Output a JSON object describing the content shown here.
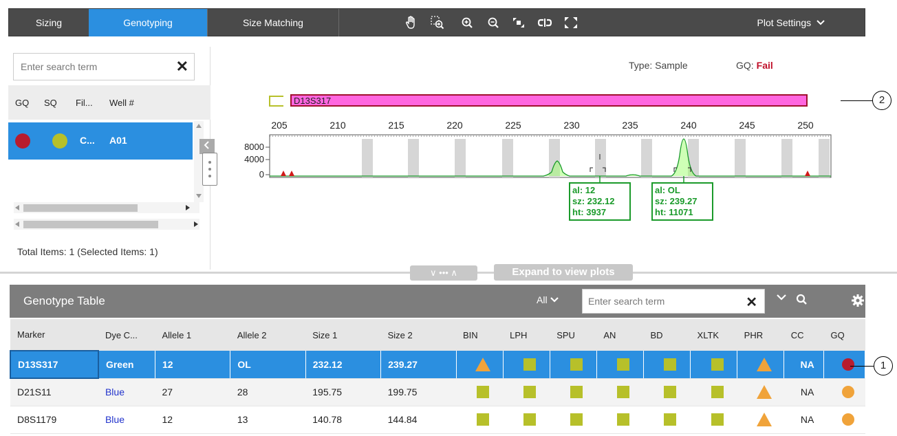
{
  "toolbar": {
    "tabs": [
      {
        "label": "Sizing",
        "active": false
      },
      {
        "label": "Genotyping",
        "active": true
      },
      {
        "label": "Size Matching",
        "active": false
      }
    ],
    "icons": [
      "pan-hand-icon",
      "zoom-box-icon",
      "zoom-in-icon",
      "zoom-out-icon",
      "fit-to-view-icon",
      "link-icon",
      "expand-icon"
    ],
    "plot_settings_label": "Plot Settings"
  },
  "sample_panel": {
    "search_placeholder": "Enter search term",
    "columns": [
      "GQ",
      "SQ",
      "Fil...",
      "Well #"
    ],
    "rows": [
      {
        "gq_color": "#b81c2e",
        "sq_color": "#b7c02a",
        "file": "C...",
        "well": "A01"
      }
    ],
    "total_text": "Total Items: 1 (Selected Items: 1)"
  },
  "plot": {
    "type_text": "Type: Sample",
    "gq_label": "GQ:",
    "gq_value": "Fail",
    "marker_label": "D13S317",
    "x_ticks": [
      "205",
      "210",
      "215",
      "220",
      "225",
      "230",
      "235",
      "240",
      "245",
      "250"
    ],
    "y_ticks": [
      "8000",
      "4000",
      "0"
    ],
    "peaks": [
      {
        "al": "al: 12",
        "sz": "sz: 232.12",
        "ht": "ht: 3937"
      },
      {
        "al": "al: OL",
        "sz": "sz: 239.27",
        "ht": "ht: 11071"
      }
    ],
    "callout_2": "2"
  },
  "expand": {
    "label": "Expand to view plots",
    "controls": "∨ ••• ∧"
  },
  "genotype_table": {
    "title": "Genotype Table",
    "filter_label": "All",
    "search_placeholder": "Enter search term",
    "columns": [
      "Marker",
      "Dye C...",
      "Allele 1",
      "Allele 2",
      "Size 1",
      "Size 2",
      "BIN",
      "LPH",
      "SPU",
      "AN",
      "BD",
      "XLTK",
      "PHR",
      "CC",
      "GQ"
    ],
    "rows": [
      {
        "marker": "D13S317",
        "dye": "Green",
        "allele1": "12",
        "allele2": "OL",
        "size1": "232.12",
        "size2": "239.27",
        "bin": "triangle",
        "phr": "triangle",
        "cc": "NA",
        "gq_color": "#b81c2e"
      },
      {
        "marker": "D21S11",
        "dye": "Blue",
        "allele1": "27",
        "allele2": "28",
        "size1": "195.75",
        "size2": "199.75",
        "bin": "square",
        "phr": "triangle",
        "cc": "NA",
        "gq_color": "#f0a33a"
      },
      {
        "marker": "D8S1179",
        "dye": "Blue",
        "allele1": "12",
        "allele2": "13",
        "size1": "140.78",
        "size2": "144.84",
        "bin": "square",
        "phr": "triangle",
        "cc": "NA",
        "gq_color": "#f0a33a"
      }
    ],
    "callout_1": "1"
  },
  "colors": {
    "accent": "#2b8fe0",
    "flag_square": "#b7c02a",
    "flag_triangle": "#f0a33a",
    "fail": "#b81c2e",
    "marker_bar": "#ff66e0",
    "peak_green": "#1a9a2a"
  }
}
